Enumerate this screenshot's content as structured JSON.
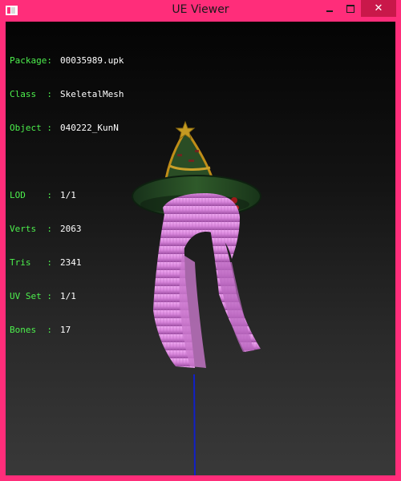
{
  "window": {
    "title": "UE Viewer",
    "accent_color": "#ff2d7a",
    "controls": {
      "minimize": "minimize-icon",
      "maximize": "maximize-icon",
      "close": "close-icon"
    }
  },
  "info": {
    "package": {
      "label": "Package:",
      "value": "00035989.upk"
    },
    "class": {
      "label": "Class  :",
      "value": "SkeletalMesh"
    },
    "object": {
      "label": "Object :",
      "value": "040222_KunN"
    },
    "lod": {
      "label": "LOD    :",
      "value": "1/1"
    },
    "verts": {
      "label": "Verts  :",
      "value": "2063"
    },
    "tris": {
      "label": "Tris   :",
      "value": "2341"
    },
    "uvset": {
      "label": "UV Set :",
      "value": "1/1"
    },
    "bones": {
      "label": "Bones  :",
      "value": "17"
    }
  },
  "colors": {
    "label": "#4df04d",
    "value": "#ffffff",
    "hair": "#e58fe8",
    "hat": "#1d3a1a",
    "axis": "#1020c8"
  }
}
